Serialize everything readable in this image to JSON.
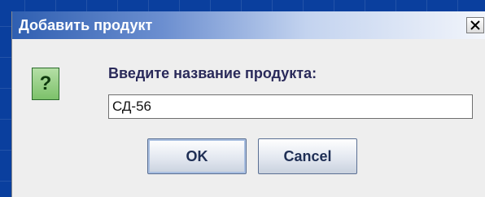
{
  "dialog": {
    "title": "Добавить продукт",
    "close_icon": "close-x-icon",
    "question_icon_glyph": "?",
    "prompt": "Введите название продукта:",
    "input_value": "СД-56",
    "ok_label": "OK",
    "cancel_label": "Cancel"
  },
  "colors": {
    "desktop_background": "#0a3f9e",
    "dialog_background": "#eeeeee",
    "titlebar_start": "#2f5fb1",
    "titlebar_end": "#f2f5fb",
    "question_icon": "#7cc16a"
  }
}
